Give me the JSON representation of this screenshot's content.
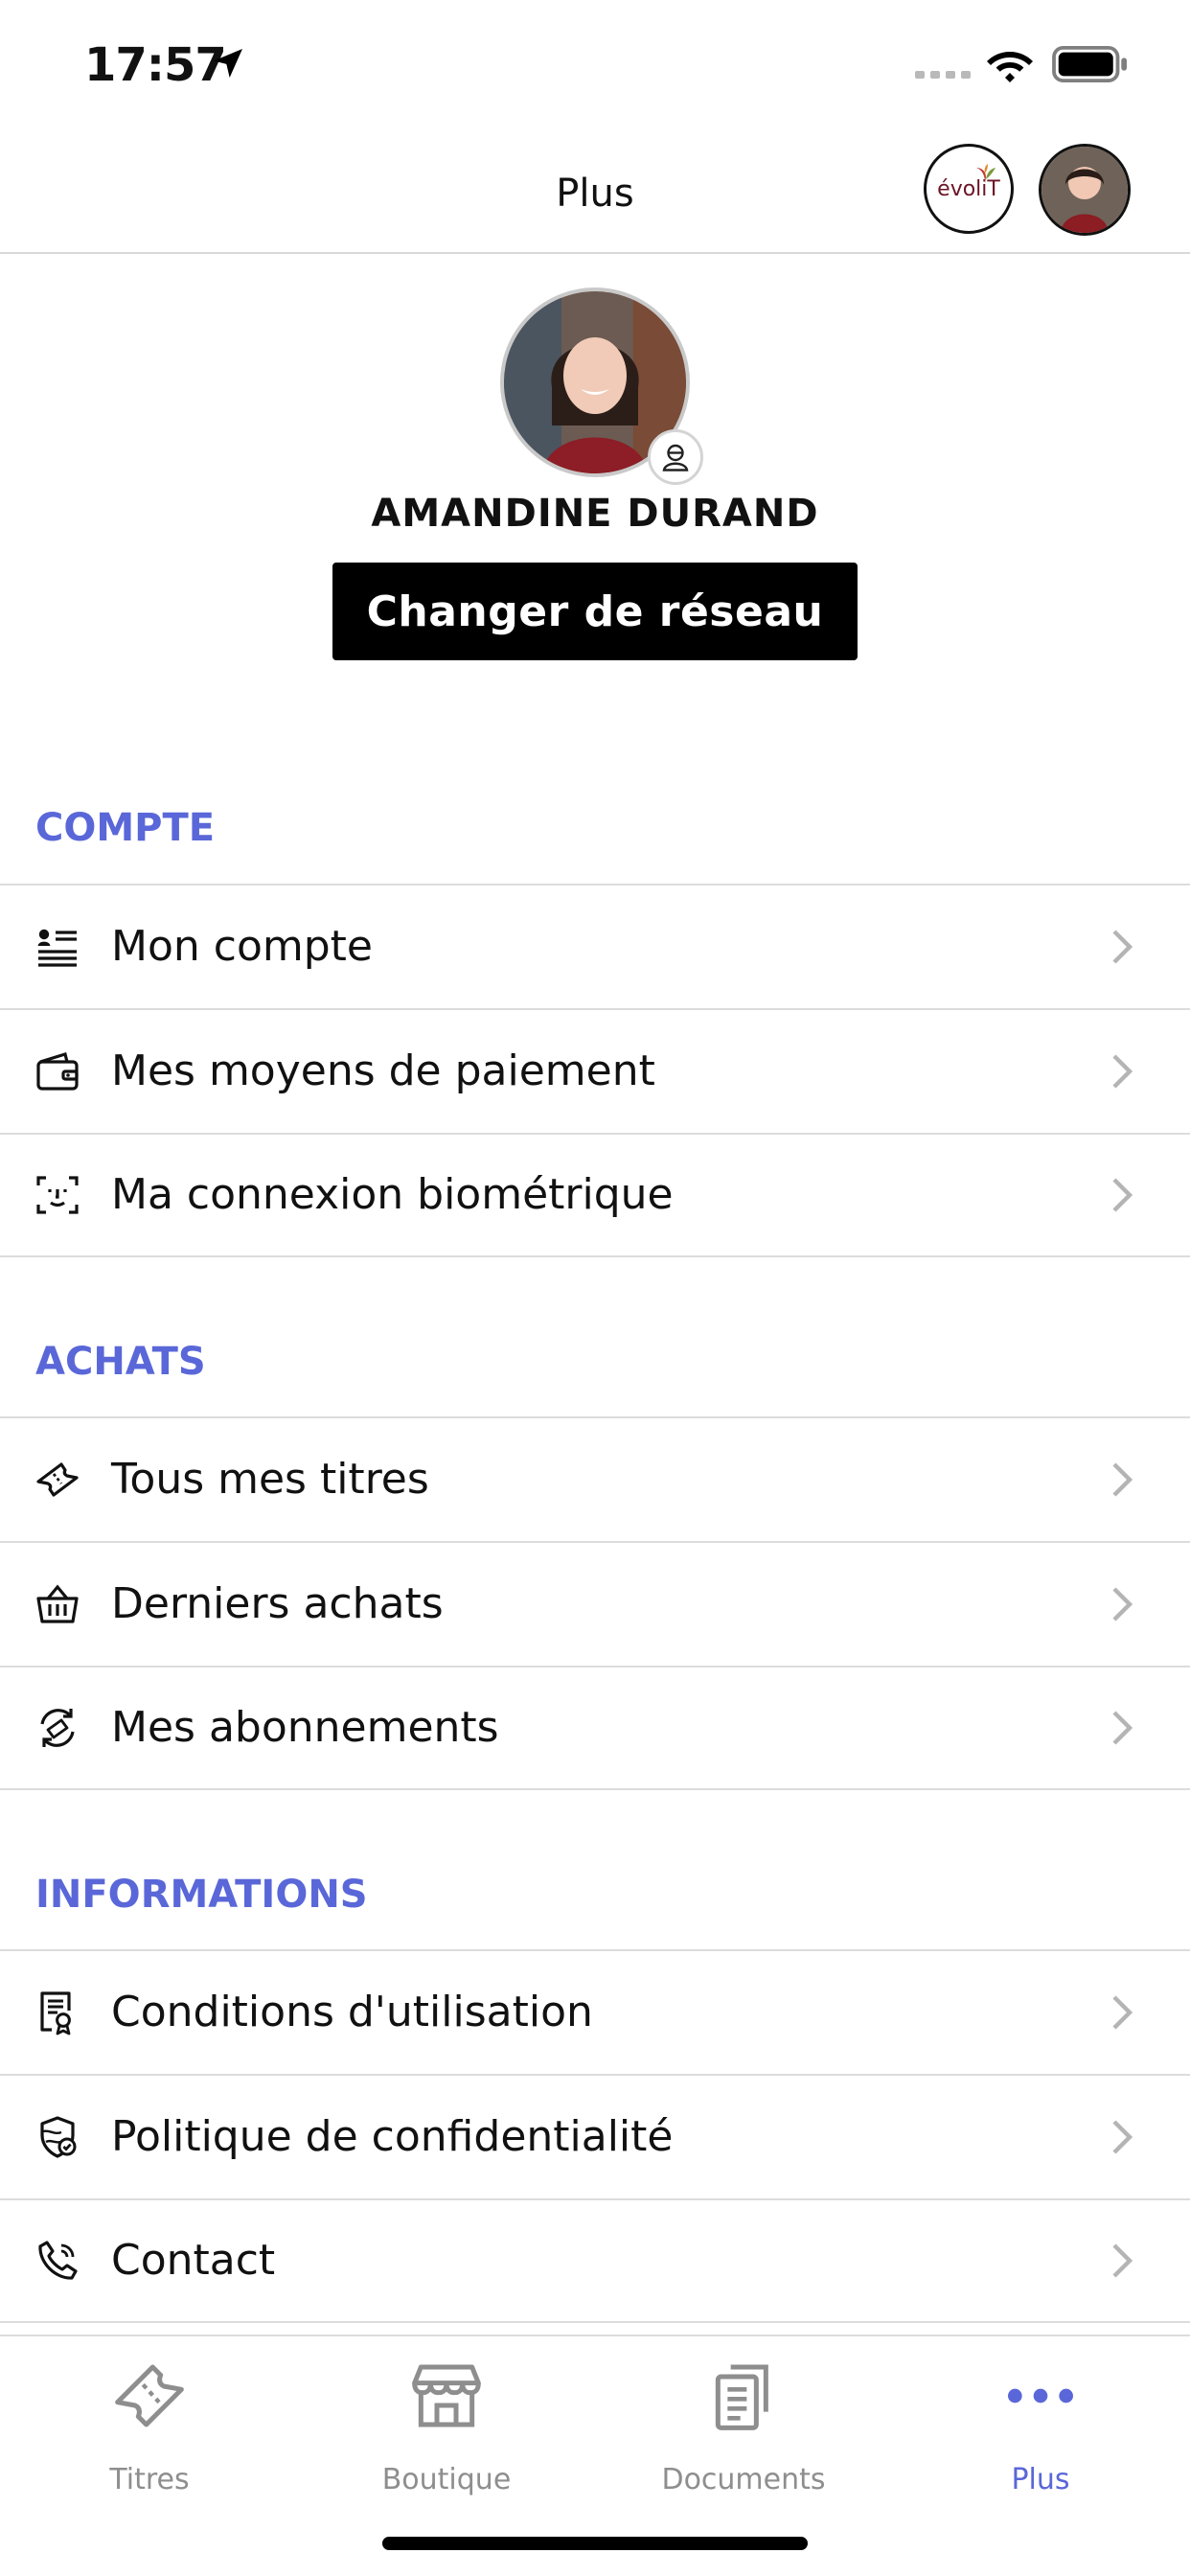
{
  "status_bar": {
    "time": "17:57"
  },
  "nav": {
    "title": "Plus",
    "brand_badge_text": "évoliT"
  },
  "profile": {
    "name": "AMANDINE DURAND",
    "switch_button_label": "Changer de réseau"
  },
  "sections": {
    "account": {
      "title": "COMPTE",
      "items": [
        {
          "label": "Mon compte",
          "icon": "profile-list-icon"
        },
        {
          "label": "Mes moyens de paiement",
          "icon": "wallet-icon"
        },
        {
          "label": "Ma connexion biométrique",
          "icon": "face-id-icon"
        }
      ]
    },
    "purchases": {
      "title": "ACHATS",
      "items": [
        {
          "label": "Tous mes titres",
          "icon": "ticket-icon"
        },
        {
          "label": "Derniers achats",
          "icon": "basket-icon"
        },
        {
          "label": "Mes abonnements",
          "icon": "subscription-icon"
        }
      ]
    },
    "information": {
      "title": "INFORMATIONS",
      "items": [
        {
          "label": "Conditions d'utilisation",
          "icon": "document-certificate-icon"
        },
        {
          "label": "Politique de confidentialité",
          "icon": "shield-check-icon"
        },
        {
          "label": "Contact",
          "icon": "phone-icon"
        }
      ]
    }
  },
  "tabbar": {
    "tabs": [
      {
        "label": "Titres",
        "icon": "ticket-icon",
        "active": false
      },
      {
        "label": "Boutique",
        "icon": "store-icon",
        "active": false
      },
      {
        "label": "Documents",
        "icon": "documents-icon",
        "active": false
      },
      {
        "label": "Plus",
        "icon": "more-dots-icon",
        "active": true
      }
    ]
  },
  "colors": {
    "accent": "#5a67d8",
    "button_bg": "#000000",
    "divider": "#dcdcdc",
    "tab_inactive": "#8e8e8e"
  }
}
